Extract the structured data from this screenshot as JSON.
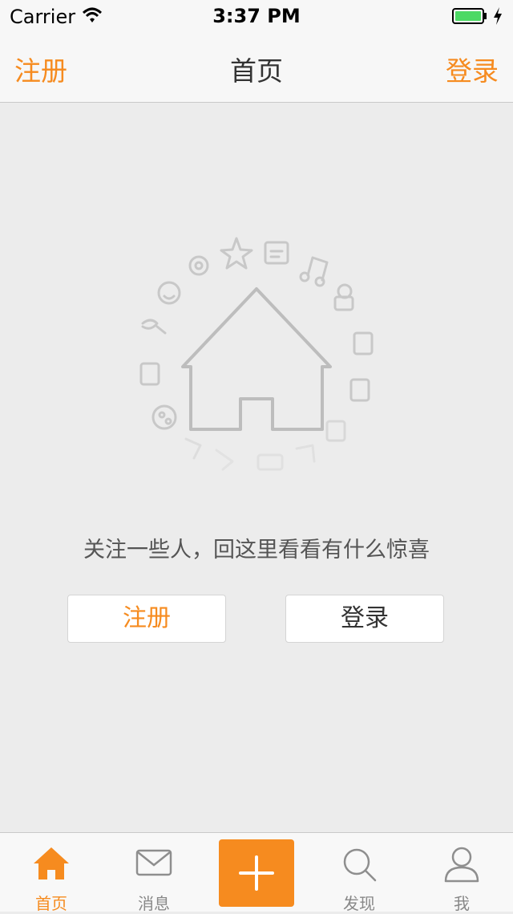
{
  "status_bar": {
    "carrier": "Carrier",
    "time": "3:37 PM"
  },
  "nav": {
    "left": "注册",
    "title": "首页",
    "right": "登录"
  },
  "empty_state": {
    "illustration": "house-with-icons-illustration",
    "message": "关注一些人，回这里看看有什么惊喜",
    "register_label": "注册",
    "login_label": "登录"
  },
  "tabs": [
    {
      "label": "首页",
      "icon": "home-icon",
      "active": true
    },
    {
      "label": "消息",
      "icon": "mail-icon",
      "active": false
    },
    {
      "label": "",
      "icon": "plus-icon",
      "active": false
    },
    {
      "label": "发现",
      "icon": "search-icon",
      "active": false
    },
    {
      "label": "我",
      "icon": "user-icon",
      "active": false
    }
  ],
  "colors": {
    "accent": "#f68b1f",
    "background": "#ececec",
    "bar": "#f7f7f7"
  }
}
